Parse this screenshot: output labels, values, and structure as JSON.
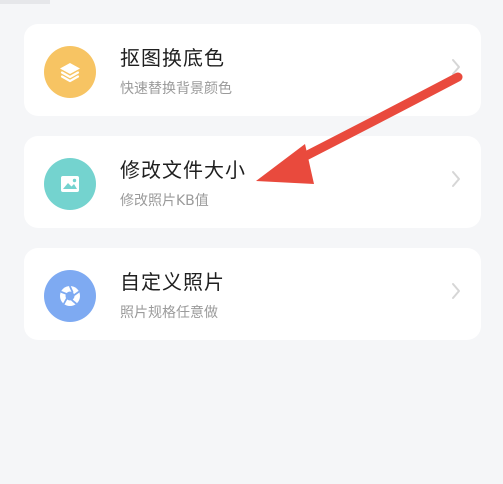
{
  "menu": {
    "items": [
      {
        "title": "抠图换底色",
        "subtitle": "快速替换背景颜色",
        "icon": "layers-icon",
        "icon_color": "#f7c463"
      },
      {
        "title": "修改文件大小",
        "subtitle": "修改照片KB值",
        "icon": "image-icon",
        "icon_color": "#74d3cf"
      },
      {
        "title": "自定义照片",
        "subtitle": "照片规格任意做",
        "icon": "aperture-icon",
        "icon_color": "#7eaaf2"
      }
    ]
  },
  "annotation": {
    "color": "#e94a3d"
  }
}
